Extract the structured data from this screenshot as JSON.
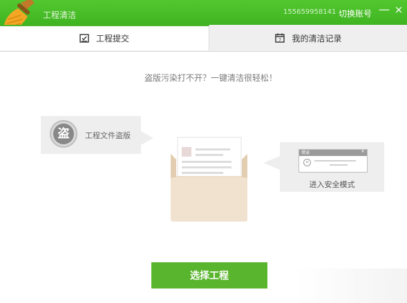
{
  "titlebar": {
    "app_title": "工程清洁",
    "account": "155659958141",
    "switch_account": "切换账号",
    "minimize": "—",
    "close": "×"
  },
  "tabs": [
    {
      "label": "工程提交",
      "icon": "checkbox-icon",
      "active": true
    },
    {
      "label": "我的清洁记录",
      "icon": "calendar-icon",
      "active": false
    }
  ],
  "main": {
    "headline": "盗版污染打不开？一键清洁很轻松！",
    "left_bubble": {
      "seal_char": "盗",
      "label": "工程文件盗版"
    },
    "right_bubble": {
      "error_title": "错误",
      "close": "×",
      "label": "进入安全模式"
    },
    "select_button": "选择工程"
  },
  "colors": {
    "accent": "#5ab52e",
    "titlebar": "#46bb25"
  }
}
